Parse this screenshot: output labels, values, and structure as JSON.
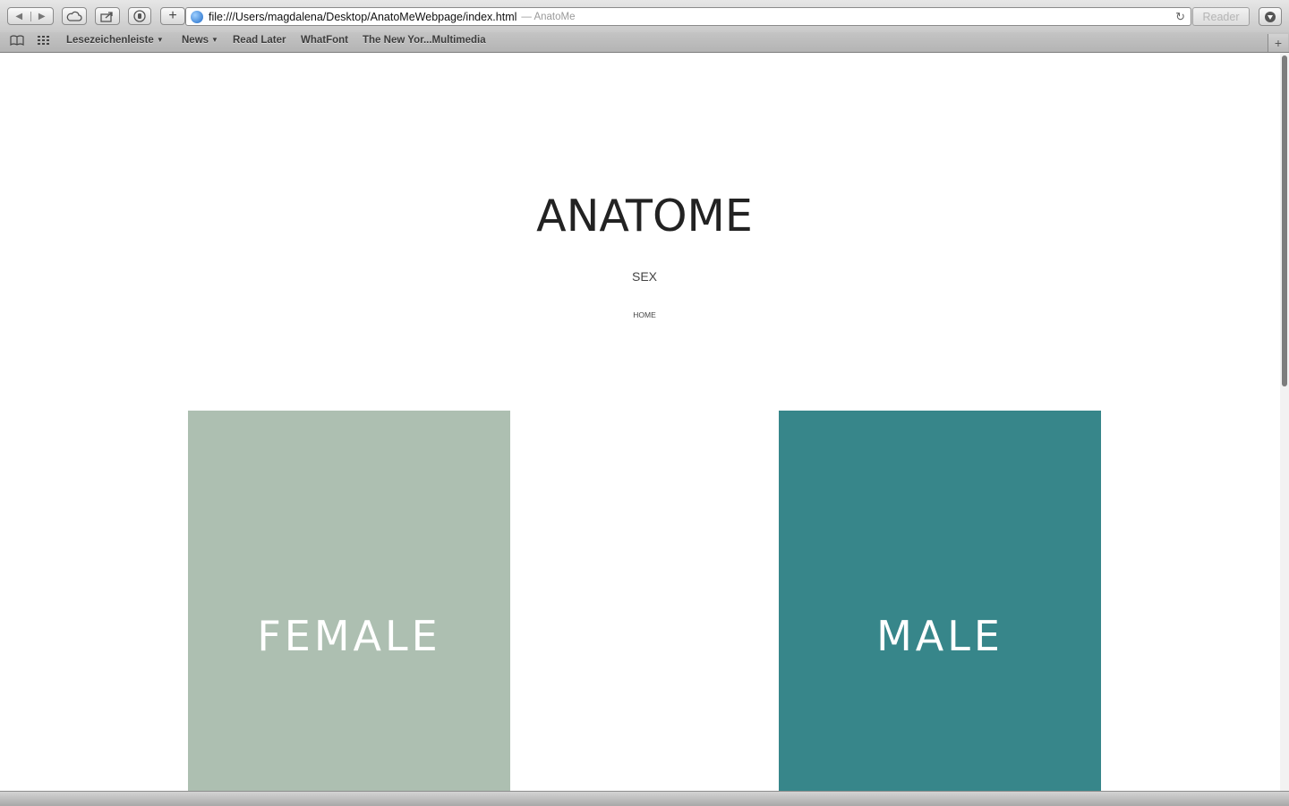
{
  "browser": {
    "url": "file:///Users/magdalena/Desktop/AnatoMeWebpage/index.html",
    "page_title": "— AnatoMe",
    "reader_label": "Reader",
    "add_label": "+",
    "bookmarks": [
      {
        "label": "Lesezeichenleiste",
        "has_menu": true
      },
      {
        "label": "News",
        "has_menu": true
      },
      {
        "label": "Read Later",
        "has_menu": false
      },
      {
        "label": "WhatFont",
        "has_menu": false
      },
      {
        "label": "The New Yor...Multimedia",
        "has_menu": false
      }
    ]
  },
  "site": {
    "logo": "ANATOME",
    "nav": "SEX",
    "home_link": "HOME",
    "cards": [
      {
        "label": "FEMALE",
        "color": "#adbfb1"
      },
      {
        "label": "MALE",
        "color": "#37868a"
      }
    ]
  },
  "icons": {
    "back": "back-arrow-icon",
    "forward": "forward-arrow-icon",
    "cloud": "icloud-tabs-icon",
    "share": "share-icon",
    "privacy": "privacy-hand-icon",
    "globe": "globe-icon",
    "reload": "reload-icon",
    "download": "download-icon",
    "reading_list": "reading-list-icon",
    "top_sites": "top-sites-grid-icon"
  }
}
